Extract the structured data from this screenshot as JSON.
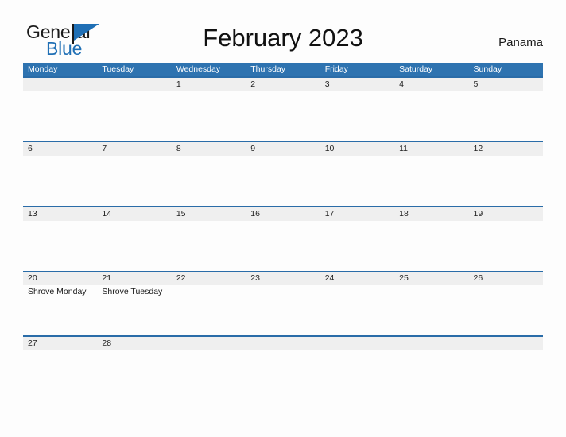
{
  "brand": {
    "name_part1": "General",
    "name_part2": "Blue",
    "flag_icon": "flag-triangle-icon",
    "color_primary": "#1f6fb5",
    "color_text": "#1a1a1a"
  },
  "header": {
    "title": "February 2023",
    "region": "Panama"
  },
  "calendar": {
    "month": "February",
    "year": "2023",
    "first_day_of_week": "Monday",
    "colors": {
      "header_blue": "#2e73b0",
      "rule_blue": "#2a6ca8",
      "number_band_gray": "#efefef",
      "page_background": "#fdfdfd"
    },
    "weekday_headers": [
      "Monday",
      "Tuesday",
      "Wednesday",
      "Thursday",
      "Friday",
      "Saturday",
      "Sunday"
    ],
    "weeks": [
      {
        "size": "tall",
        "days": [
          {
            "num": "",
            "events": []
          },
          {
            "num": "",
            "events": []
          },
          {
            "num": "1",
            "events": []
          },
          {
            "num": "2",
            "events": []
          },
          {
            "num": "3",
            "events": []
          },
          {
            "num": "4",
            "events": []
          },
          {
            "num": "5",
            "events": []
          }
        ]
      },
      {
        "size": "tall",
        "days": [
          {
            "num": "6",
            "events": []
          },
          {
            "num": "7",
            "events": []
          },
          {
            "num": "8",
            "events": []
          },
          {
            "num": "9",
            "events": []
          },
          {
            "num": "10",
            "events": []
          },
          {
            "num": "11",
            "events": []
          },
          {
            "num": "12",
            "events": []
          }
        ]
      },
      {
        "size": "tall",
        "days": [
          {
            "num": "13",
            "events": []
          },
          {
            "num": "14",
            "events": []
          },
          {
            "num": "15",
            "events": []
          },
          {
            "num": "16",
            "events": []
          },
          {
            "num": "17",
            "events": []
          },
          {
            "num": "18",
            "events": []
          },
          {
            "num": "19",
            "events": []
          }
        ]
      },
      {
        "size": "tall",
        "days": [
          {
            "num": "20",
            "events": [
              "Shrove Monday"
            ]
          },
          {
            "num": "21",
            "events": [
              "Shrove Tuesday"
            ]
          },
          {
            "num": "22",
            "events": []
          },
          {
            "num": "23",
            "events": []
          },
          {
            "num": "24",
            "events": []
          },
          {
            "num": "25",
            "events": []
          },
          {
            "num": "26",
            "events": []
          }
        ]
      },
      {
        "size": "short",
        "days": [
          {
            "num": "27",
            "events": []
          },
          {
            "num": "28",
            "events": []
          },
          {
            "num": "",
            "events": []
          },
          {
            "num": "",
            "events": []
          },
          {
            "num": "",
            "events": []
          },
          {
            "num": "",
            "events": []
          },
          {
            "num": "",
            "events": []
          }
        ]
      }
    ]
  }
}
